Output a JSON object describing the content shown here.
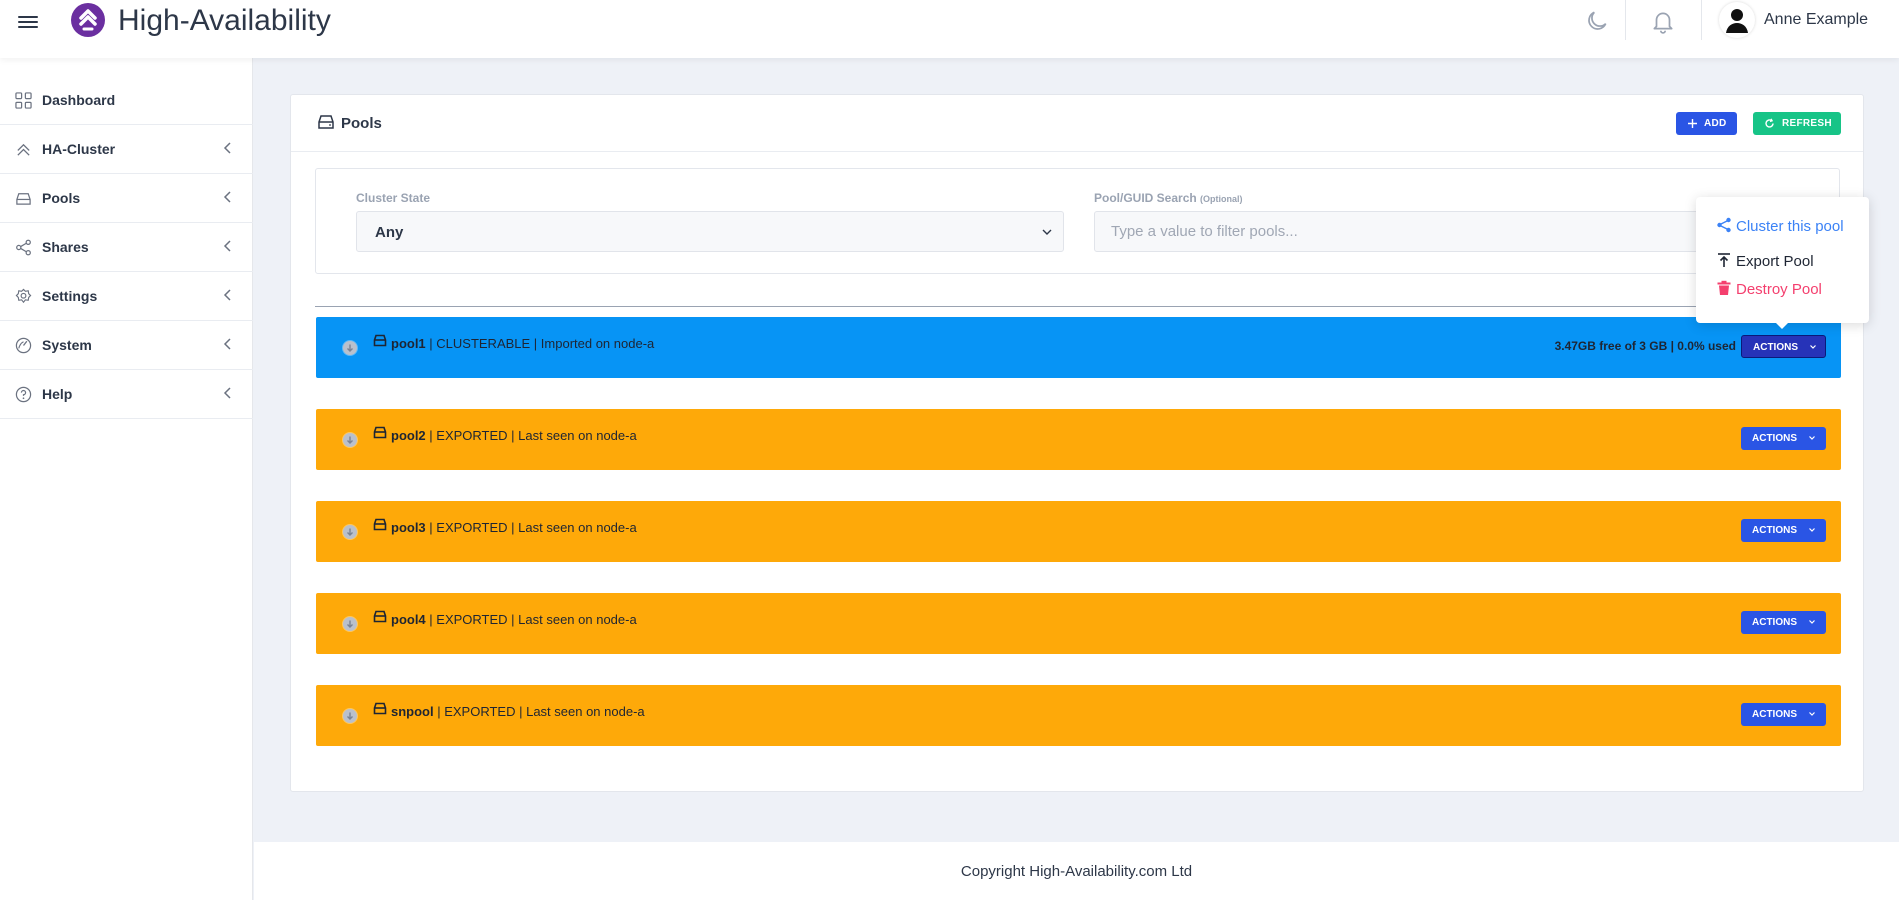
{
  "app": {
    "title": "High-Availability"
  },
  "user": {
    "name": "Anne Example"
  },
  "sidebar": {
    "items": [
      {
        "label": "Dashboard",
        "icon": "grid-icon",
        "has_children": false
      },
      {
        "label": "HA-Cluster",
        "icon": "chevrons-up-icon",
        "has_children": true
      },
      {
        "label": "Pools",
        "icon": "hard-drive-icon",
        "has_children": true
      },
      {
        "label": "Shares",
        "icon": "share-icon",
        "has_children": true
      },
      {
        "label": "Settings",
        "icon": "gear-icon",
        "has_children": true
      },
      {
        "label": "System",
        "icon": "gauge-icon",
        "has_children": true
      },
      {
        "label": "Help",
        "icon": "help-circle-icon",
        "has_children": true
      }
    ]
  },
  "card": {
    "title": "Pools",
    "add_label": "ADD",
    "refresh_label": "REFRESH"
  },
  "filters": {
    "cluster_state_label": "Cluster State",
    "cluster_state_value": "Any",
    "search_label": "Pool/GUID Search",
    "search_label_hint": "(Optional)",
    "search_placeholder": "Type a value to filter pools...",
    "search_value": ""
  },
  "pools": [
    {
      "name": "pool1",
      "status_text": " | CLUSTERABLE | Imported on node-a",
      "usage": "3.47GB free of 3 GB | 0.0% used",
      "color": "#0794f5",
      "actions_label": "ACTIONS"
    },
    {
      "name": "pool2",
      "status_text": " | EXPORTED | Last seen on node-a",
      "usage": "",
      "color": "#fea909",
      "actions_label": "ACTIONS"
    },
    {
      "name": "pool3",
      "status_text": " | EXPORTED | Last seen on node-a",
      "usage": "",
      "color": "#fea909",
      "actions_label": "ACTIONS"
    },
    {
      "name": "pool4",
      "status_text": " | EXPORTED | Last seen on node-a",
      "usage": "",
      "color": "#fea909",
      "actions_label": "ACTIONS"
    },
    {
      "name": "snpool",
      "status_text": " | EXPORTED | Last seen on node-a",
      "usage": "",
      "color": "#fea909",
      "actions_label": "ACTIONS"
    }
  ],
  "actions_menu": {
    "items": [
      {
        "label": "Cluster this pool",
        "icon": "share-icon",
        "color": "#3b82f6"
      },
      {
        "label": "Export Pool",
        "icon": "export-icon",
        "color": "#1e2533"
      },
      {
        "label": "Destroy Pool",
        "icon": "trash-icon",
        "color": "#f43f6e"
      }
    ]
  },
  "footer": {
    "text": "Copyright High-Availability.com Ltd"
  },
  "colors": {
    "primary": "#2a55e5",
    "success": "#17c487",
    "clusterable": "#0794f5",
    "exported": "#fea909",
    "danger": "#f43f6e"
  }
}
